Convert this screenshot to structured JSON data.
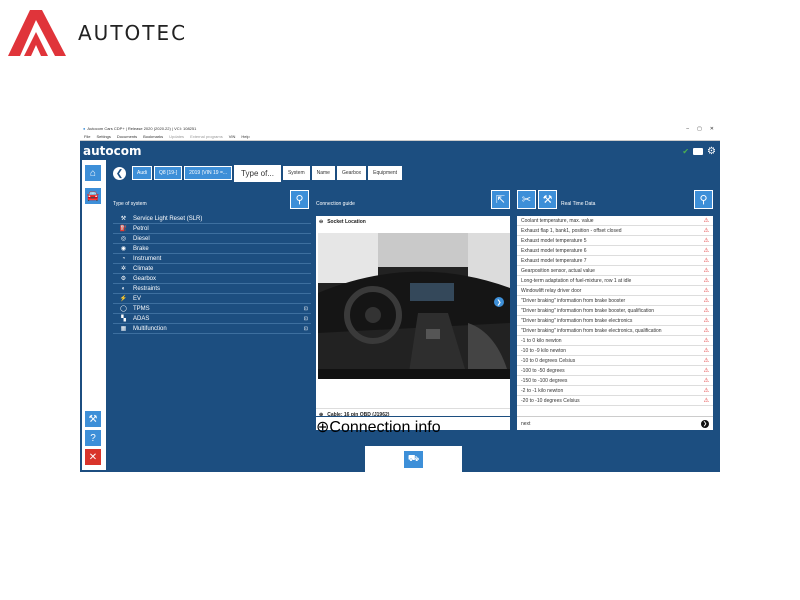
{
  "brand": {
    "name": "AUTOTEC"
  },
  "window": {
    "title": "Autocom Cars CDP+ | Release 2020 (2020.22) | VCI: 108251",
    "controls": [
      "–",
      "▢",
      "✕"
    ],
    "menu": [
      "File",
      "Settings",
      "Documents",
      "Bookmarks",
      "Updates",
      "External programs",
      "VIN",
      "Help"
    ]
  },
  "app": {
    "logo": "autocom"
  },
  "breadcrumb": {
    "items": [
      "Audi",
      "Q8 [19-]",
      "2019 (VIN 19 =..."
    ],
    "active": "Type of...",
    "tabs": [
      "System",
      "Name",
      "Gearbox",
      "Equipment"
    ]
  },
  "systems": {
    "title": "Type of system",
    "items": [
      {
        "label": "Service Light Reset (SLR)",
        "icon": "wrench-icon",
        "glyph": "⚒"
      },
      {
        "label": "Petrol",
        "icon": "fuel-icon",
        "glyph": "⛽"
      },
      {
        "label": "Diesel",
        "icon": "diesel-icon",
        "glyph": "◎"
      },
      {
        "label": "Brake",
        "icon": "brake-icon",
        "glyph": "◉"
      },
      {
        "label": "Instrument",
        "icon": "instrument-icon",
        "glyph": "◔"
      },
      {
        "label": "Climate",
        "icon": "climate-icon",
        "glyph": "✲"
      },
      {
        "label": "Gearbox",
        "icon": "gearbox-icon",
        "glyph": "⚙"
      },
      {
        "label": "Restraints",
        "icon": "restraints-icon",
        "glyph": "◐"
      },
      {
        "label": "EV",
        "icon": "ev-icon",
        "glyph": "⚡"
      },
      {
        "label": "TPMS",
        "icon": "tpms-icon",
        "glyph": "◯",
        "trail": "⊡"
      },
      {
        "label": "ADAS",
        "icon": "adas-icon",
        "glyph": "▚",
        "trail": "⊡"
      },
      {
        "label": "Multifunction",
        "icon": "multifunction-icon",
        "glyph": "▦",
        "trail": "⊡"
      }
    ]
  },
  "connection": {
    "title": "Connection guide",
    "socket": "Socket Location",
    "cable": "Cable: 16 pin OBD (J1962)",
    "info": "Connection info"
  },
  "realtime": {
    "title": "Real Time Data",
    "items": [
      "Coolant temperature, max. value",
      "Exhaust flap 1, bank1, position - offset closed",
      "Exhaust model temperature 5",
      "Exhaust model temperature 6",
      "Exhaust model temperature 7",
      "Gearposition sensor, actual value",
      "Long-term adaptation of fuel-mixture, row 1 at idle",
      "Windowlift relay driver door",
      "\"Driver braking\" information from brake booster",
      "\"Driver braking\" information from brake booster, qualification",
      "\"Driver braking\" information from brake electronics",
      "\"Driver braking\" information from brake electronics, qualification",
      "-1 to 0 kilo newton",
      "-10 to -9 kilo newton",
      "-10 to 0 degrees Celsius",
      "-100 to -50 degrees",
      "-150 to -100 degrees",
      "-2 to -1 kilo newton",
      "-20 to -10 degrees Celsius"
    ],
    "next": "next"
  },
  "colors": {
    "window": "#1c4e80",
    "button": "#3d8fd8",
    "logo": "#e0343a",
    "warn": "#e03030"
  }
}
